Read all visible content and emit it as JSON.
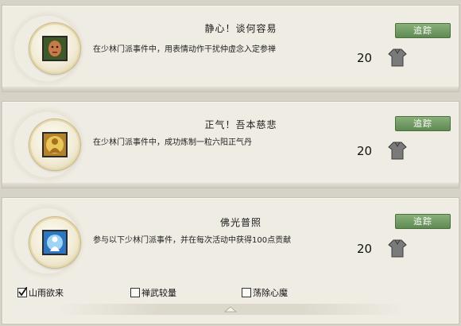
{
  "achievements": [
    {
      "title": "静心！谈何容易",
      "description": "在少林门派事件中，用表情动作干扰仲虚念入定参禅",
      "points": "20",
      "track_label": "追踪",
      "icon": "monk-head-icon"
    },
    {
      "title": "正气！吾本慈悲",
      "description": "在少林门派事件中，成功炼制一粒六阳正气丹",
      "points": "20",
      "track_label": "追踪",
      "icon": "golden-buddha-icon"
    },
    {
      "title": "佛光普照",
      "description": "参与以下少林门派事件，并在每次活动中获得100点贡献",
      "points": "20",
      "track_label": "追踪",
      "icon": "glowing-monk-icon",
      "sub_events": [
        {
          "label": "山雨欲来",
          "checked": true
        },
        {
          "label": "禅武较量",
          "checked": false
        },
        {
          "label": "荡除心魔",
          "checked": false
        }
      ]
    }
  ],
  "colors": {
    "track_button": "#6f9a62",
    "card_bg": "#efece4",
    "page_bg": "#d6d2c8"
  }
}
